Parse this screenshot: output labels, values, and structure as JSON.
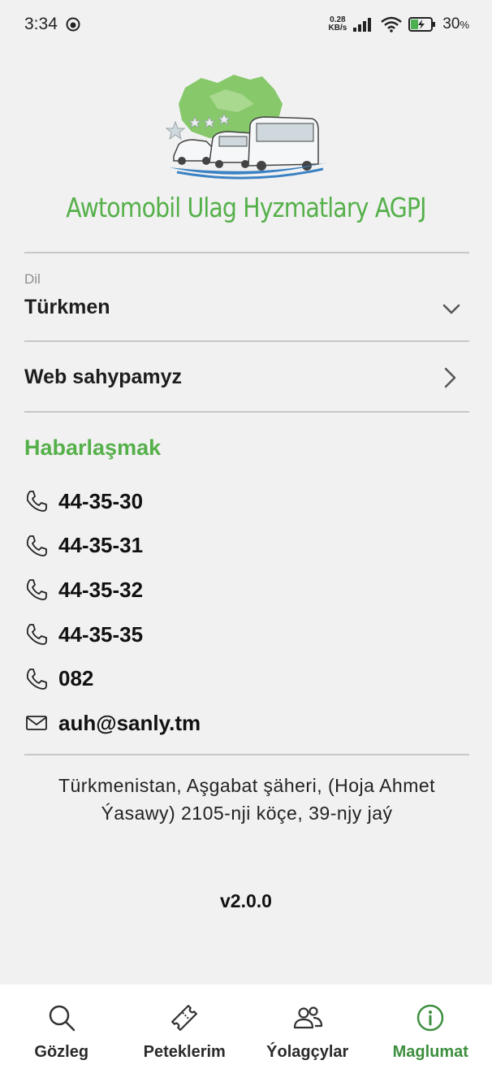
{
  "status_bar": {
    "time": "3:34",
    "net_speed_value": "0.28",
    "net_speed_unit": "KB/s",
    "battery_percent": "30",
    "battery_unit": "%"
  },
  "header": {
    "app_name": "Awtomobil Ulag Hyzmatlary AGPJ"
  },
  "language": {
    "label": "Dil",
    "value": "Türkmen"
  },
  "website": {
    "label": "Web sahypamyz"
  },
  "contact": {
    "title": "Habarlaşmak",
    "items": [
      {
        "type": "phone",
        "value": "44-35-30"
      },
      {
        "type": "phone",
        "value": "44-35-31"
      },
      {
        "type": "phone",
        "value": "44-35-32"
      },
      {
        "type": "phone",
        "value": "44-35-35"
      },
      {
        "type": "phone",
        "value": "082"
      },
      {
        "type": "email",
        "value": "auh@sanly.tm"
      }
    ]
  },
  "address": "Türkmenistan, Aşgabat şäheri, (Hoja Ahmet Ýasawy) 2105-nji köçe, 39-njy jaý",
  "version": "v2.0.0",
  "bottom_nav": {
    "items": [
      {
        "label": "Gözleg",
        "icon": "search-icon"
      },
      {
        "label": "Peteklerim",
        "icon": "ticket-icon"
      },
      {
        "label": "Ýolagçylar",
        "icon": "passengers-icon"
      },
      {
        "label": "Maglumat",
        "icon": "info-icon",
        "active": true
      }
    ]
  },
  "colors": {
    "accent": "#55b04a",
    "active_nav": "#3d8f3f",
    "background": "#f1f1f1"
  }
}
